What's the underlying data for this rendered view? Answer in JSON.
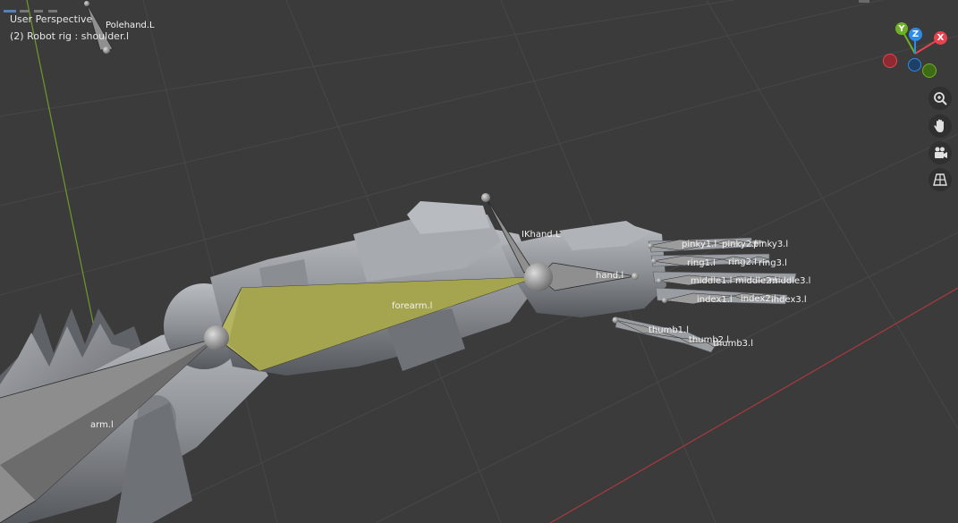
{
  "viewport": {
    "view_name": "User Perspective",
    "object_info": "(2) Robot rig : shoulder.l"
  },
  "bones": {
    "polehand": "Polehand.L",
    "ikhand": "IKhand.L",
    "hand": "hand.l",
    "forearm": "forearm.l",
    "arm": "arm.l",
    "pinky1": "pinky1.l",
    "pinky2": "pinky2.l",
    "pinky3": "pinky3.l",
    "ring1": "ring1.l",
    "ring2": "ring2.l",
    "ring3": "ring3.l",
    "middle1": "middle1.l",
    "middle2": "middle2.l",
    "middle3": "middle3.l",
    "index1": "index1.l",
    "index2": "index2.l",
    "index3": "index3.l",
    "thumb1": "thumb1.l",
    "thumb2": "thumb2.l",
    "thumb3": "thumb3.l"
  },
  "gizmo": {
    "x_label": "X",
    "y_label": "Y",
    "z_label": "Z",
    "x_color": "#e8434f",
    "y_color": "#6fb125",
    "z_color": "#2d8ceb"
  },
  "nav_tools": [
    "zoom-icon",
    "hand-pan-icon",
    "camera-icon",
    "grid-ortho-icon"
  ],
  "colors": {
    "background": "#3b3b3b",
    "grid": "#4a4a4a",
    "y_axis_line": "#6e9a2a",
    "x_axis_line": "#a83a3f",
    "selected_bone": "#b4b461",
    "bone": "#8a8a8a",
    "mesh": "#9b9ea3"
  }
}
